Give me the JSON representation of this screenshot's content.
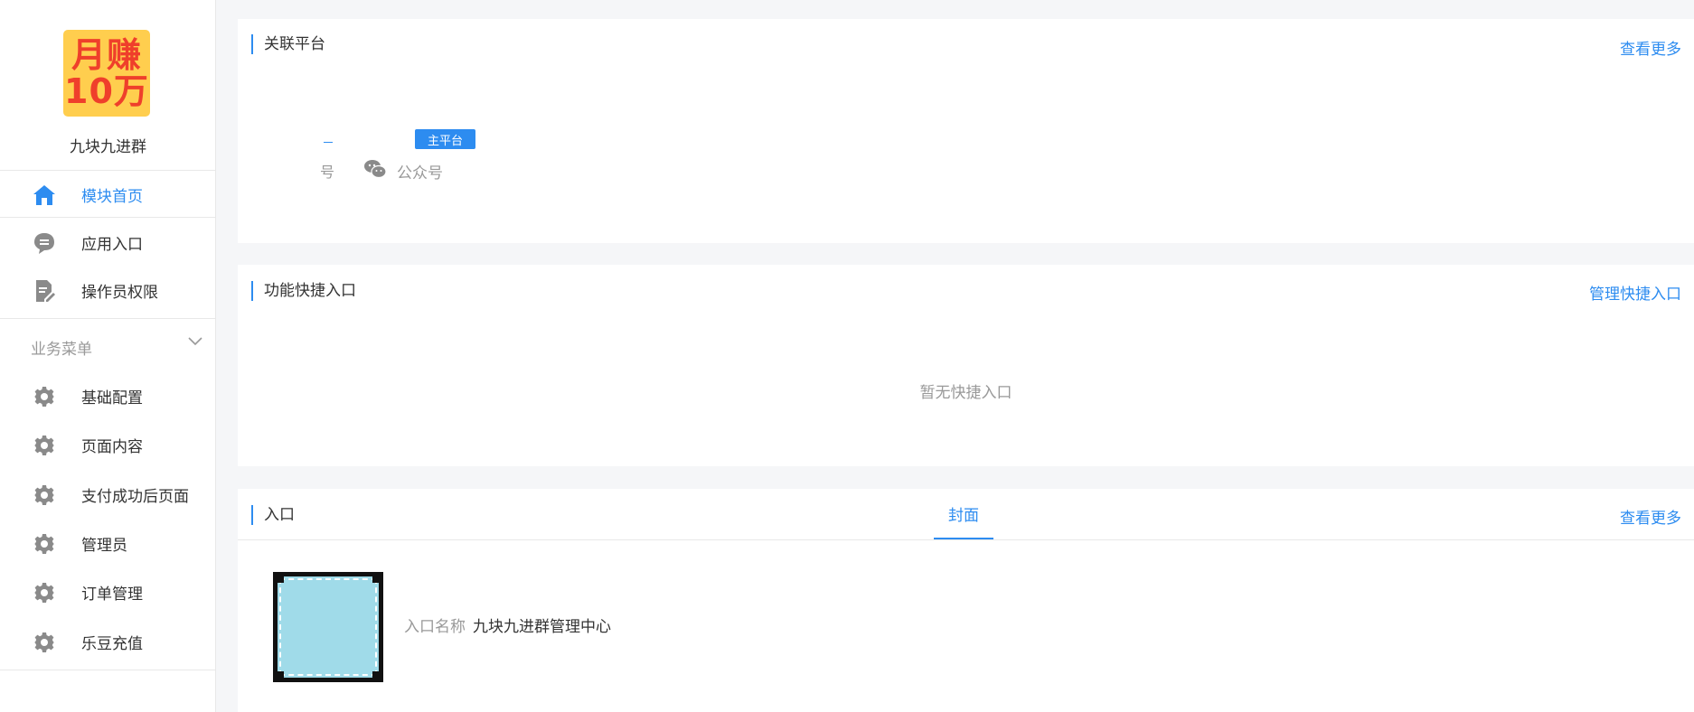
{
  "sidebar": {
    "logo": {
      "line1": "月赚",
      "line2": "10万"
    },
    "shop_name": "九块九进群",
    "items": [
      {
        "label": "模块首页",
        "icon": "home-icon",
        "active": true
      },
      {
        "label": "应用入口",
        "icon": "chat-icon"
      },
      {
        "label": "操作员权限",
        "icon": "document-edit-icon"
      }
    ],
    "group": {
      "title": "业务菜单",
      "items": [
        {
          "label": "基础配置",
          "icon": "gear-icon"
        },
        {
          "label": "页面内容",
          "icon": "gear-icon"
        },
        {
          "label": "支付成功后页面",
          "icon": "gear-icon"
        },
        {
          "label": "管理员",
          "icon": "gear-icon"
        },
        {
          "label": "订单管理",
          "icon": "gear-icon"
        },
        {
          "label": "乐豆充值",
          "icon": "gear-icon"
        }
      ]
    }
  },
  "platforms_card": {
    "title": "关联平台",
    "more_label": "查看更多",
    "badge": "主平台",
    "fragment": "号",
    "platform_name": "公众号"
  },
  "shortcut_card": {
    "title": "功能快捷入口",
    "manage_label": "管理快捷入口",
    "empty_text": "暂无快捷入口"
  },
  "entry_card": {
    "title": "入口",
    "tab_label": "封面",
    "more_label": "查看更多",
    "entry_name_label": "入口名称",
    "entry_name_value": "九块九进群管理中心"
  },
  "colors": {
    "accent": "#2d8cf0",
    "logo_bg": "#ffce4e",
    "logo_text": "#ef3f2b"
  }
}
